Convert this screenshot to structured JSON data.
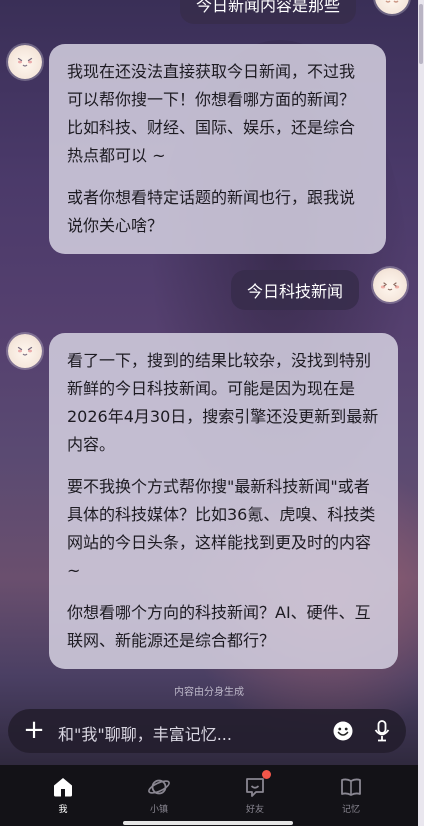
{
  "chat": {
    "top_user_message": "今日新闻内容是那些",
    "ai_reply_1": {
      "p1": "我现在还没法直接获取今日新闻，不过我可以帮你搜一下！你想看哪方面的新闻？比如科技、财经、国际、娱乐，还是综合热点都可以 ~",
      "p2": "或者你想看特定话题的新闻也行，跟我说说你关心啥？"
    },
    "user_message_2": "今日科技新闻",
    "ai_reply_2": {
      "p1": "看了一下，搜到的结果比较杂，没找到特别新鲜的今日科技新闻。可能是因为现在是2026年4月30日，搜索引擎还没更新到最新内容。",
      "p2": "要不我换个方式帮你搜\"最新科技新闻\"或者具体的科技媒体？比如36氪、虎嗅、科技类网站的今日头条，这样能找到更及时的内容 ~",
      "p3": "你想看哪个方向的科技新闻？AI、硬件、互联网、新能源还是综合都行？"
    }
  },
  "generated_note": "内容由分身生成",
  "input": {
    "placeholder": "和\"我\"聊聊，丰富记忆..."
  },
  "tabs": [
    {
      "label": "我",
      "icon": "home-icon",
      "active": true
    },
    {
      "label": "小镇",
      "icon": "planet-icon",
      "active": false
    },
    {
      "label": "好友",
      "icon": "chat-smile-icon",
      "active": false,
      "badge": true
    },
    {
      "label": "记忆",
      "icon": "book-icon",
      "active": false
    }
  ],
  "colors": {
    "badge": "#f2564a",
    "tabbar_bg": "#131217",
    "ai_bubble": "#d2cdde"
  }
}
